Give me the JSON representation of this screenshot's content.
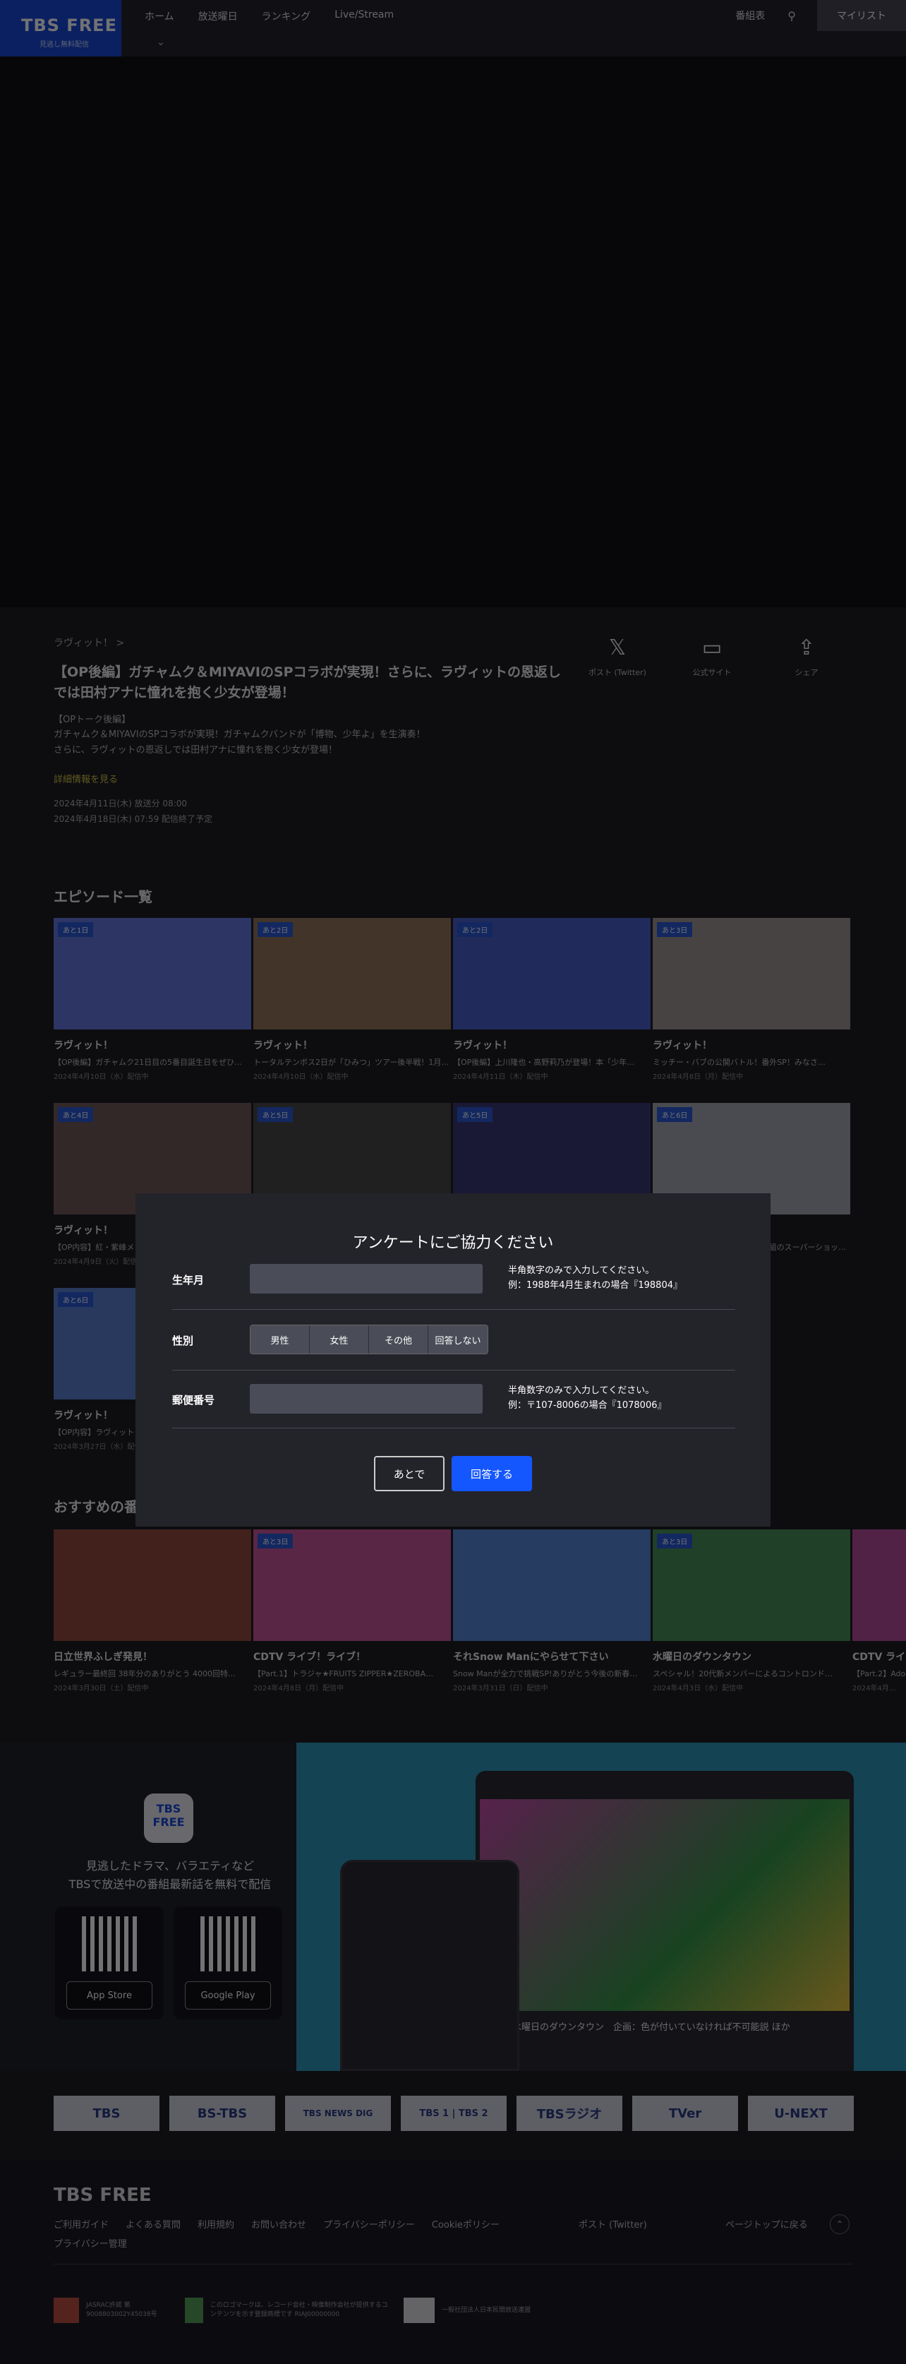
{
  "header": {
    "logo": "TBS FREE",
    "logo_sub": "見逃し無料配信",
    "nav": [
      "ホーム",
      "放送曜日",
      "ランキング",
      "Live/Stream"
    ],
    "schedule": "番組表",
    "mylist": "マイリスト"
  },
  "episode": {
    "breadcrumb": "ラヴィット！ >",
    "title": "【OP後編】ガチャムク＆MIYAVIのSPコラボが実現！さらに、ラヴィットの恩返しでは田村アナに憧れを抱く少女が登場！",
    "desc": [
      "【OPトーク後編】",
      "ガチャムク＆MIYAVIのSPコラボが実現！ガチャムクバンドが「博物、少年よ」を生演奏！",
      "さらに、ラヴィットの恩返しでは田村アナに憧れを抱く少女が登場！"
    ],
    "more": "詳細情報を見る",
    "broadcast": "2024年4月11日(木) 放送分 08:00",
    "expires": "2024年4月18日(木) 07:59 配信終了予定",
    "share_x": "ポスト (Twitter)",
    "share_site": "公式サイト",
    "share": "シェア"
  },
  "episodes_title": "エピソード一覧",
  "episodes": [
    {
      "badge": "あと1日",
      "title": "ラヴィット！",
      "sub": "【OP後編】ガチャムク21日目の5番目誕生日をぜひ…",
      "date": "2024年4月10日（水）配信中",
      "bg": "#5a6fd8"
    },
    {
      "badge": "あと2日",
      "title": "ラヴィット！",
      "sub": "トータルテンボス2日が「ひみつ」ツアー後半戦！1月…",
      "date": "2024年4月10日（水）配信中",
      "bg": "#8c6b4e"
    },
    {
      "badge": "あと2日",
      "title": "ラヴィット！",
      "sub": "【OP後編】上川隆也・高野莉乃が登場！本「少年…",
      "date": "2024年4月11日（木）配信中",
      "bg": "#3d55c4"
    },
    {
      "badge": "あと3日",
      "title": "ラヴィット！",
      "sub": "ミッチー・バブの公開バトル！番外SP！みなさ…",
      "date": "2024年4月8日（月）配信中",
      "bg": "#9a8f88"
    },
    {
      "badge": "あと4日",
      "title": "ラヴィット！",
      "sub": "【OP内容】紅・紫峰メンバーのファンのみなさまへ…",
      "date": "2024年4月9日（火）配信中",
      "bg": "#6a4f4a"
    },
    {
      "badge": "あと5日",
      "title": "ラヴィット！",
      "sub": "",
      "date": "",
      "bg": "#3f3c3a"
    },
    {
      "badge": "あと5日",
      "title": "ラヴィット！",
      "sub": "",
      "date": "",
      "bg": "#2f2b6a"
    },
    {
      "badge": "あと6日",
      "title": "ラヴィット！",
      "sub": "レガシーフィールド公開バトル番組のスーパーショット…",
      "date": "",
      "bg": "#9da2a9"
    },
    {
      "badge": "あと6日",
      "title": "ラヴィット！",
      "sub": "【OP内容】ラヴィット！2時間SP…",
      "date": "2024年3月27日（水）配信中",
      "bg": "#4f77c8"
    }
  ],
  "recommend_title": "おすすめの番組",
  "recommend": [
    {
      "badge": "",
      "title": "日立世界ふしぎ発見！",
      "sub": "レギュラー最終回 38年分のありがとう 4000回特…",
      "date": "2024年3月30日（土）配信中",
      "bg": "#8e3f2e"
    },
    {
      "badge": "あと3日",
      "title": "CDTV ライブ！ライブ！",
      "sub": "【Part.1】トラジャ★FRUITS ZIPPER★ZEROBA…",
      "date": "2024年4月8日（月）配信中",
      "bg": "#c54a8f"
    },
    {
      "badge": "",
      "title": "それSnow Manにやらせて下さい",
      "sub": "Snow Manが全力で挑戦SP!ありがとう今後の新春…",
      "date": "2024年3月31日（日）配信中",
      "bg": "#4a7fd0"
    },
    {
      "badge": "あと3日",
      "title": "水曜日のダウンタウン",
      "sub": "スペシャル！20代新メンバーによるコントロンド…",
      "date": "2024年4月3日（水）配信中",
      "bg": "#3c8a4a"
    },
    {
      "badge": "",
      "title": "CDTV ライブ！ライブ！",
      "sub": "【Part.2】Ado★…",
      "date": "2024年4月…",
      "bg": "#b04090"
    }
  ],
  "promo": {
    "icon": "TBS FREE",
    "text1": "見逃したドラマ、バラエティなど",
    "text2": "TBSで放送中の番組最新話を無料で配信",
    "appstore": "App Store",
    "googleplay": "Google Play",
    "tablet_caption": "水曜日のダウンタウン　企画：色が付いていなければ不可能説 ほか"
  },
  "partners": [
    "TBS",
    "BS-TBS",
    "TBS NEWS DIG",
    "TBS 1 | TBS 2",
    "TBSラジオ",
    "TVer",
    "U-NEXT"
  ],
  "footer": {
    "logo": "TBS FREE",
    "links": [
      "ご利用ガイド",
      "よくある質問",
      "利用規約",
      "お問い合わせ",
      "プライバシーポリシー",
      "Cookieポリシー",
      "プライバシー管理"
    ],
    "x": "ポスト (Twitter)",
    "pagetop": "ページトップに戻る",
    "cert1": "JASRAC許諾 第9008803002Y45038号",
    "cert2": "このロゴマークは、レコード会社・映像制作会社が提供するコンテンツを示す登録商標です RIAJ00000000",
    "cert3": "一般社団法人日本民間放送連盟"
  },
  "survey": {
    "title": "アンケートにご協力ください",
    "birth_label": "生年月",
    "birth_hint1": "半角数字のみで入力してください。",
    "birth_hint2": "例：1988年4月生まれの場合『198804』",
    "gender_label": "性別",
    "genders": [
      "男性",
      "女性",
      "その他",
      "回答しない"
    ],
    "zip_label": "郵便番号",
    "zip_hint1": "半角数字のみで入力してください。",
    "zip_hint2": "例：〒107-8006の場合『1078006』",
    "later": "あとで",
    "submit": "回答する"
  }
}
